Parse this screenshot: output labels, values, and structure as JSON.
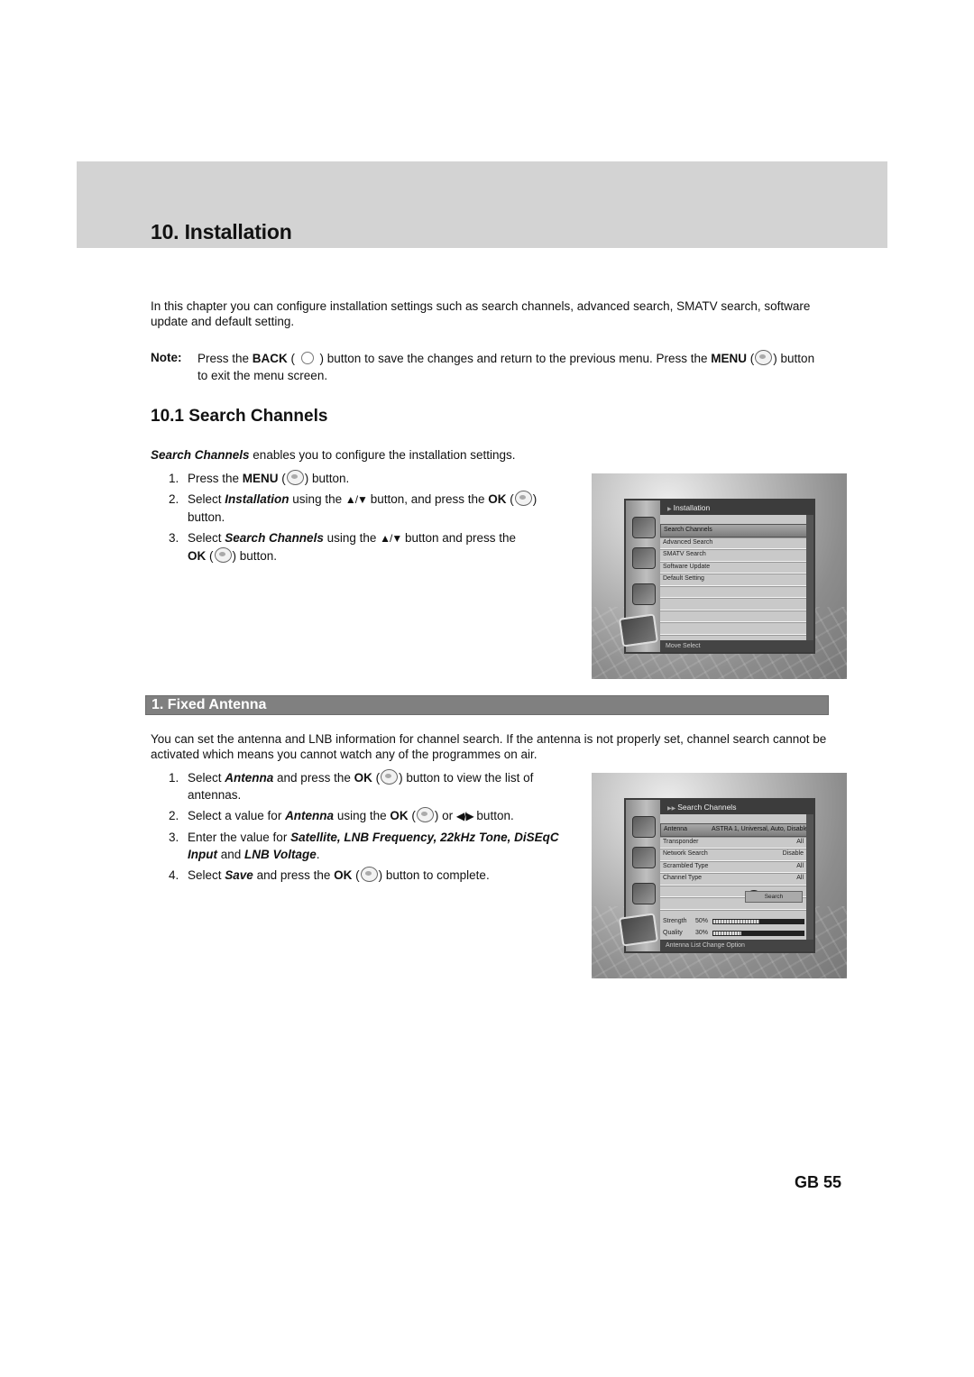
{
  "chapter": {
    "title": "10. Installation",
    "intro": "In this chapter you can configure installation settings such as search channels, advanced search, SMATV search, software update and default setting.",
    "note": {
      "label": "Note:",
      "t1": "Press the ",
      "back": "BACK",
      "t2": " ( ",
      "t3": " ) button to save the changes and return to the previous menu. Press the ",
      "menu": "MENU",
      "t4": " (",
      "t5": ") button to exit the menu screen."
    }
  },
  "section": {
    "title": "10.1 Search Channels",
    "intro_em": "Search Channels",
    "intro_rest": " enables you to configure the installation settings.",
    "steps": [
      {
        "num": "1.",
        "a": "Press the ",
        "b": "MENU",
        "c": " (",
        "d": ") button."
      },
      {
        "num": "2.",
        "a": "Select ",
        "b": "Installation",
        "c": " using the ",
        "arrows": "▲/▼",
        "d": " button, and press the ",
        "e": "OK",
        "f": " (",
        "g": ") button."
      },
      {
        "num": "3.",
        "a": "Select ",
        "b": "Search Channels",
        "c": " using the ",
        "arrows": "▲/▼",
        "d": " button and press the ",
        "e": "OK",
        "f": " (",
        "g": ") button."
      }
    ]
  },
  "tv_installation": {
    "title": "Installation",
    "items": [
      "Search Channels",
      "Advanced Search",
      "SMATV Search",
      "Software Update",
      "Default Setting",
      "",
      "",
      "",
      ""
    ],
    "selected_index": 0,
    "footer": "Move   Select"
  },
  "subsection": {
    "title": "1. Fixed Antenna",
    "intro": "You can set the antenna and LNB information for channel search. If the antenna is not properly set, channel search cannot be activated which means you cannot watch any of the programmes on air.",
    "steps": [
      {
        "num": "1.",
        "a": "Select ",
        "b": "Antenna",
        "c": " and press the ",
        "d": "OK",
        "e": " (",
        "f": ") button to view the list of antennas."
      },
      {
        "num": "2.",
        "a": "Select a value for ",
        "b": "Antenna",
        "c": " using the ",
        "d": "OK",
        "e": " (",
        "f": ") or ",
        "arrows": "◀/▶",
        "g": " button."
      },
      {
        "num": "3.",
        "a": "Enter the value for ",
        "b": "Satellite, LNB Frequency, 22kHz Tone, DiSEqC Input",
        "c": " and ",
        "d": "LNB Voltage",
        "e": "."
      },
      {
        "num": "4.",
        "a": "Select ",
        "b": "Save",
        "c": " and press the ",
        "d": "OK",
        "e": " (",
        "f": ") button to complete."
      }
    ]
  },
  "tv_search": {
    "title": "Search Channels",
    "rows": [
      {
        "label": "Antenna",
        "value": "ASTRA 1, Universal, Auto, Disable"
      },
      {
        "label": "Transponder",
        "value": "All"
      },
      {
        "label": "Network Search",
        "value": "Disable"
      },
      {
        "label": "Scrambled Type",
        "value": "All"
      },
      {
        "label": "Channel Type",
        "value": "All"
      }
    ],
    "search_button": "Search",
    "strength": {
      "label": "Strength",
      "percent_text": "50%",
      "value": 0.5
    },
    "quality": {
      "label": "Quality",
      "percent_text": "30%",
      "value": 0.3
    },
    "footer": "Antenna List   Change Option"
  },
  "page_number": "GB 55"
}
